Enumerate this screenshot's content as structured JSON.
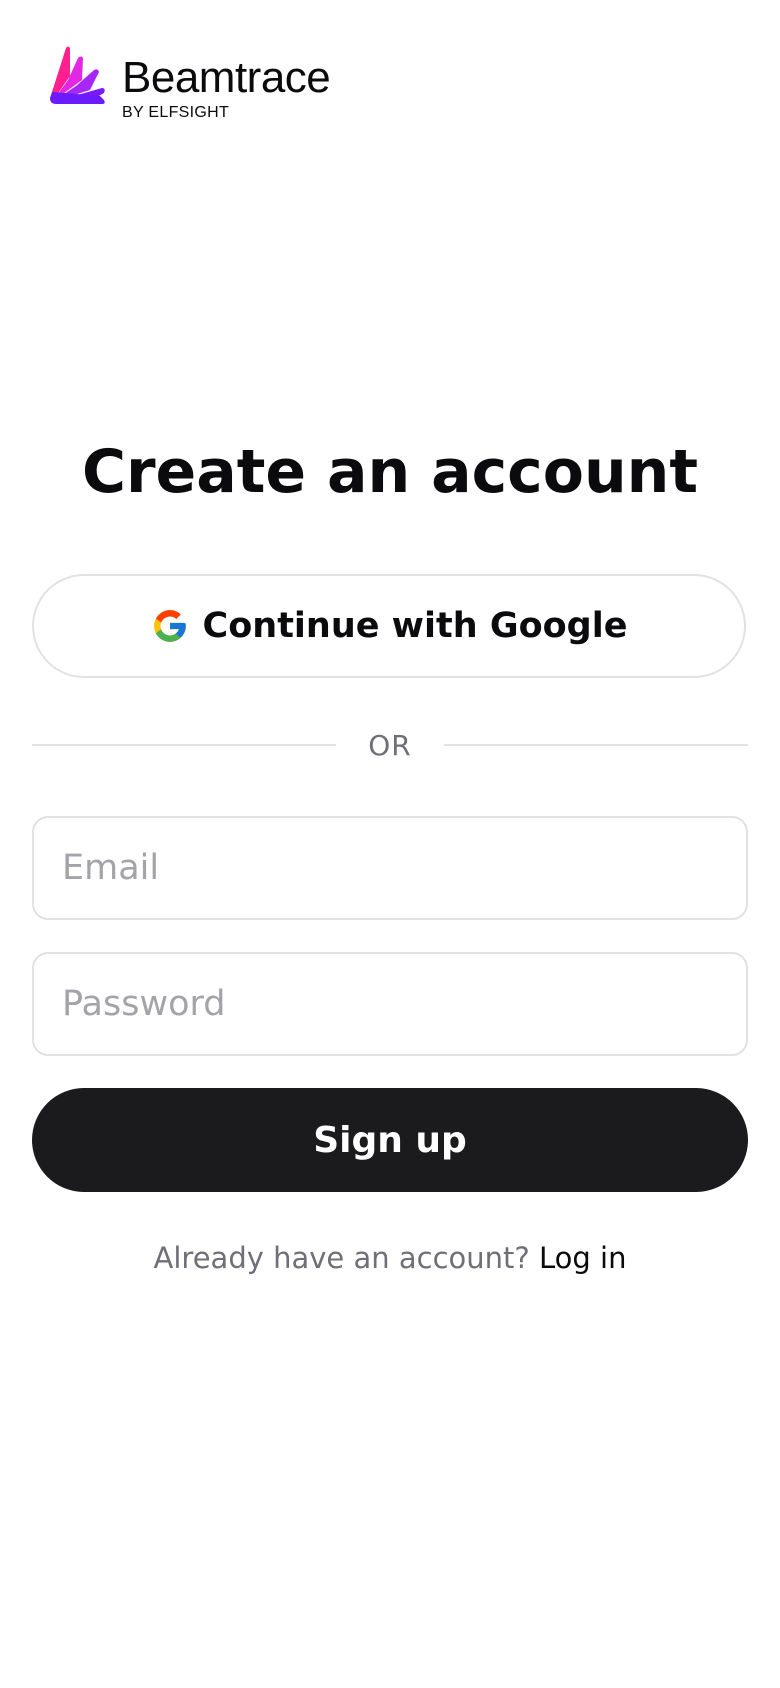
{
  "brand": {
    "name": "Beamtrace",
    "sub": "BY ELFSIGHT",
    "logo_icon": "beamtrace-logo-icon",
    "gradient_colors": [
      "#ff1f8f",
      "#c21cf0",
      "#6a1bff"
    ]
  },
  "page": {
    "title": "Create an account"
  },
  "google": {
    "label": "Continue with Google",
    "icon": "google-icon"
  },
  "divider": {
    "text": "OR"
  },
  "form": {
    "email": {
      "placeholder": "Email",
      "value": ""
    },
    "password": {
      "placeholder": "Password",
      "value": ""
    },
    "submit_label": "Sign up"
  },
  "footer": {
    "prompt": "Already have an account?",
    "link": "Log in"
  },
  "colors": {
    "primary_button": "#1b1b1e",
    "border": "#e2e2e5",
    "muted_text": "#6f6f78",
    "placeholder": "#a3a3aa"
  }
}
